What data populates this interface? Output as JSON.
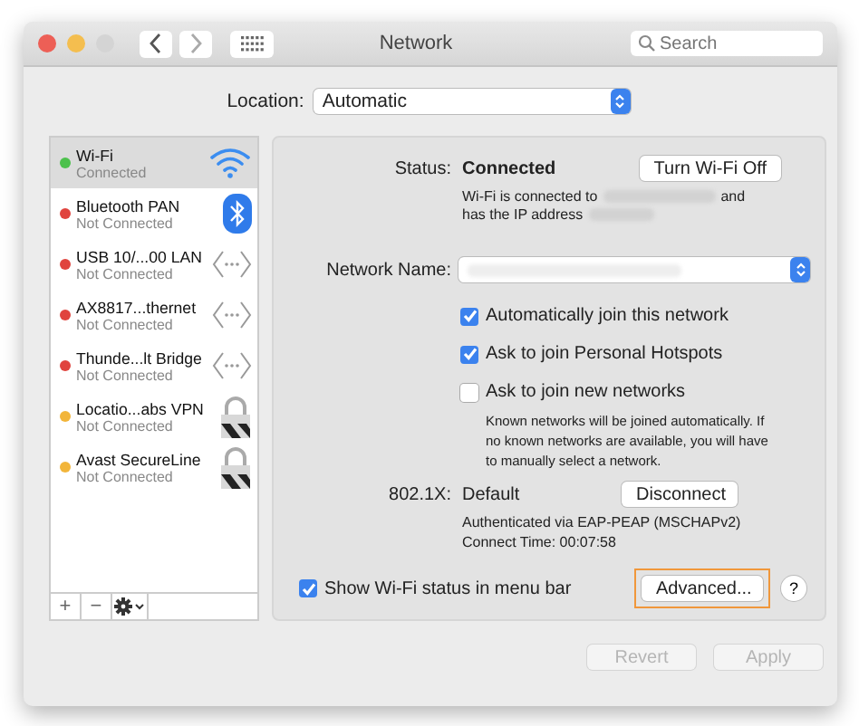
{
  "window": {
    "title": "Network"
  },
  "search": {
    "placeholder": "Search"
  },
  "location": {
    "label": "Location:",
    "value": "Automatic"
  },
  "services": [
    {
      "name": "Wi-Fi",
      "status": "Connected",
      "color": "#4cc14c",
      "kind": "wifi",
      "selected": true
    },
    {
      "name": "Bluetooth PAN",
      "status": "Not Connected",
      "color": "#e0443e",
      "kind": "bluetooth",
      "selected": false
    },
    {
      "name": "USB 10/...00 LAN",
      "status": "Not Connected",
      "color": "#e0443e",
      "kind": "ethernet",
      "selected": false
    },
    {
      "name": "AX8817...thernet",
      "status": "Not Connected",
      "color": "#e0443e",
      "kind": "ethernet",
      "selected": false
    },
    {
      "name": "Thunde...lt Bridge",
      "status": "Not Connected",
      "color": "#e0443e",
      "kind": "ethernet",
      "selected": false
    },
    {
      "name": "Locatio...abs VPN",
      "status": "Not Connected",
      "color": "#f2b53a",
      "kind": "vpn",
      "selected": false
    },
    {
      "name": "Avast SecureLine",
      "status": "Not Connected",
      "color": "#f2b53a",
      "kind": "vpn",
      "selected": false
    }
  ],
  "sidebar_footer": {
    "add": "+",
    "remove": "−"
  },
  "status": {
    "label": "Status:",
    "value": "Connected",
    "button": "Turn Wi-Fi Off",
    "line_1": "Wi-Fi is connected to",
    "line_1_end": "and",
    "line_2": "has the IP address"
  },
  "network_name": {
    "label": "Network Name:"
  },
  "options": [
    {
      "label": "Automatically join this network",
      "checked": true
    },
    {
      "label": "Ask to join Personal Hotspots",
      "checked": true
    },
    {
      "label": "Ask to join new networks",
      "checked": false
    }
  ],
  "options_note": "Known networks will be joined automatically. If no known networks are available, you will have to manually select a network.",
  "dot1x": {
    "label": "802.1X:",
    "value": "Default",
    "button": "Disconnect",
    "line_1": "Authenticated via EAP-PEAP (MSCHAPv2)",
    "line_2": "Connect Time: 00:07:58"
  },
  "show_status": {
    "label": "Show Wi-Fi status in menu bar",
    "checked": true
  },
  "advanced_button": {
    "label": "Advanced...",
    "highlighted": true
  },
  "help": "?",
  "footer_buttons": [
    {
      "label": "Revert",
      "disabled": true
    },
    {
      "label": "Apply",
      "disabled": true
    }
  ]
}
